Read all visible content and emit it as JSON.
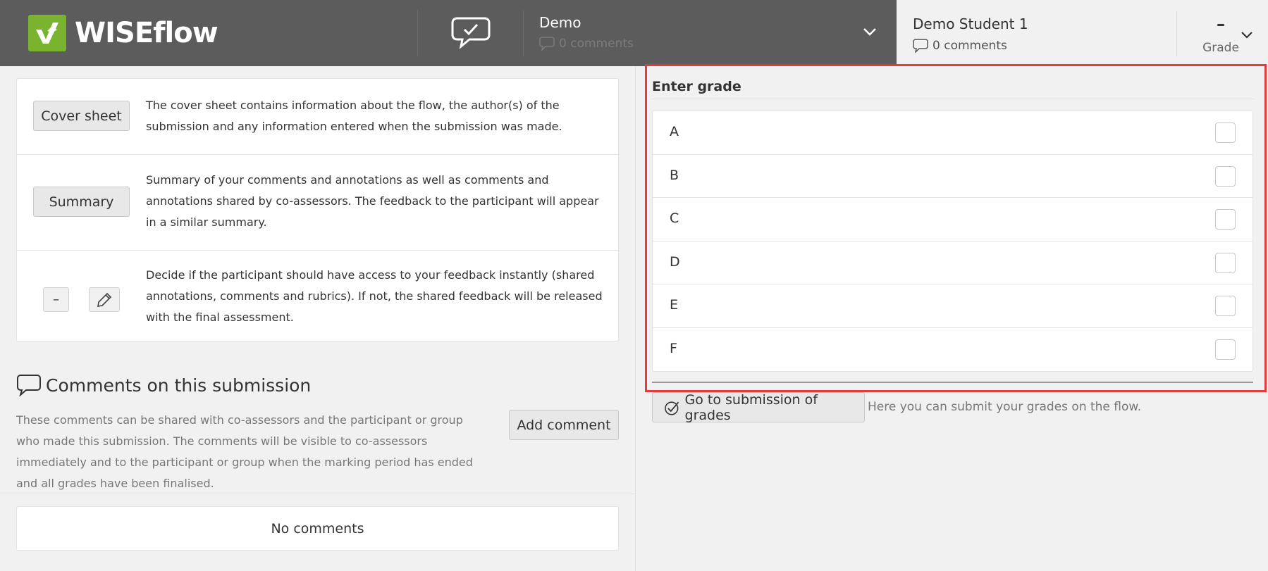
{
  "header": {
    "logo_text": "WISEflow",
    "flow": {
      "title": "Demo",
      "comments": "0 comments"
    },
    "student": {
      "name": "Demo Student 1",
      "comments": "0 comments",
      "grade_value": "–",
      "grade_label": "Grade"
    }
  },
  "left": {
    "cover_sheet": {
      "button": "Cover sheet",
      "text": "The cover sheet contains information about the flow, the author(s) of the submission and any information entered when the submission was made."
    },
    "summary": {
      "button": "Summary",
      "text": "Summary of your comments and annotations as well as comments and annotations shared by co-assessors. The feedback to the participant will appear in a similar summary."
    },
    "feedback_access": {
      "value": "–",
      "text": "Decide if the participant should have access to your feedback instantly (shared annotations, comments and rubrics). If not, the shared feedback will be released with the final assessment."
    },
    "comments": {
      "heading": "Comments on this submission",
      "description": "These comments can be shared with co-assessors and the participant or group who made this submission. The comments will be visible to co-assessors immediately and to the participant or group when the marking period has ended and all grades have been finalised.",
      "add_button": "Add comment",
      "empty": "No comments"
    }
  },
  "right": {
    "enter_grade_label": "Enter grade",
    "grades": [
      "A",
      "B",
      "C",
      "D",
      "E",
      "F"
    ],
    "submit_button": "Go to submission of grades",
    "submit_hint": "Here you can submit your grades on the flow."
  },
  "colors": {
    "header_bg": "#5c5c5c",
    "logo_green": "#7ab32e",
    "highlight": "#e23b3b",
    "panel_bg": "#f1f1f1"
  }
}
